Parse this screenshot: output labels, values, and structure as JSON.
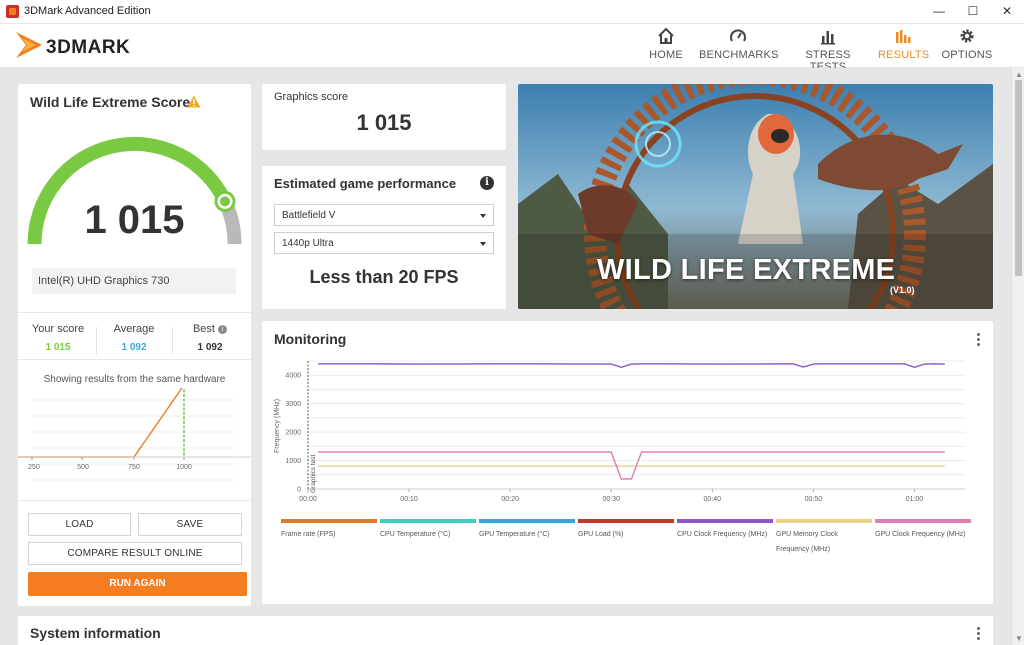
{
  "window": {
    "title": "3DMark Advanced Edition",
    "minimize": "—",
    "maximize": "☐",
    "close": "✕"
  },
  "header": {
    "logo_text": "3DMARK",
    "nav": [
      {
        "label": "HOME",
        "icon": "home-icon"
      },
      {
        "label": "BENCHMARKS",
        "icon": "gauge-icon"
      },
      {
        "label": "STRESS TESTS",
        "icon": "bar-chart-icon"
      },
      {
        "label": "RESULTS",
        "icon": "results-icon",
        "active": true
      },
      {
        "label": "OPTIONS",
        "icon": "gear-icon"
      }
    ]
  },
  "score_card": {
    "title": "Wild Life Extreme Score",
    "score": "1 015",
    "gauge_fraction": 0.86,
    "hardware": "Intel(R) UHD Graphics 730",
    "your_score_label": "Your score",
    "your_score": "1 015",
    "average_label": "Average",
    "average": "1 092",
    "best_label": "Best",
    "best": "1 092",
    "showing_text": "Showing results from the same hardware",
    "dist_ticks": [
      "250",
      "500",
      "750",
      "1000"
    ],
    "load_label": "LOAD",
    "save_label": "SAVE",
    "compare_label": "COMPARE RESULT ONLINE",
    "run_again_label": "RUN AGAIN"
  },
  "graphics": {
    "label": "Graphics score",
    "value": "1 015"
  },
  "game_perf": {
    "title": "Estimated game performance",
    "info_glyph": "i",
    "game": "Battlefield V",
    "preset": "1440p Ultra",
    "result": "Less than 20 FPS"
  },
  "hero": {
    "title": "WILD LIFE EXTREME",
    "version": "(V1.0)"
  },
  "monitoring": {
    "title": "Monitoring",
    "y_label": "Frequency (MHz)",
    "marker_label": "Graphics test",
    "y_ticks": [
      "4000",
      "3000",
      "2000",
      "1000",
      "0"
    ],
    "x_ticks": [
      "00:00",
      "00:10",
      "00:20",
      "00:30",
      "00:40",
      "00:50",
      "01:00"
    ],
    "legend": [
      {
        "label": "Frame rate (FPS)",
        "color": "#e07b2a"
      },
      {
        "label": "CPU Temperature (°C)",
        "color": "#3fd0bd"
      },
      {
        "label": "GPU Temperature (°C)",
        "color": "#34a6d9"
      },
      {
        "label": "GPU Load (%)",
        "color": "#c0392b"
      },
      {
        "label": "CPU Clock Frequency (MHz)",
        "color": "#8e55c7"
      },
      {
        "label": "GPU Memory Clock Frequency (MHz)",
        "color": "#e8cf8a"
      },
      {
        "label": "GPU Clock Frequency (MHz)",
        "color": "#e07fb3"
      }
    ]
  },
  "system_info": {
    "title": "System information"
  },
  "chart_data": {
    "type": "line",
    "title": "Monitoring",
    "xlabel": "",
    "ylabel": "Frequency (MHz)",
    "ylim": [
      0,
      4500
    ],
    "x": [
      0,
      5,
      10,
      20,
      29,
      30,
      31,
      32,
      33,
      40,
      47,
      48,
      49,
      50,
      58,
      59,
      60,
      61,
      62
    ],
    "series": [
      {
        "name": "CPU Clock Frequency (MHz)",
        "values": [
          4400,
          4400,
          4390,
          4400,
          4390,
          4280,
          4390,
          4400,
          4400,
          4390,
          4400,
          4290,
          4390,
          4400,
          4400,
          4280,
          4390,
          4400,
          4390
        ]
      },
      {
        "name": "GPU Memory Clock Frequency (MHz)",
        "values": [
          800,
          800,
          800,
          800,
          800,
          800,
          800,
          800,
          800,
          800,
          800,
          800,
          800,
          800,
          800,
          800,
          800,
          800,
          800
        ]
      },
      {
        "name": "GPU Clock Frequency (MHz)",
        "values": [
          1300,
          1300,
          1300,
          1300,
          1300,
          350,
          350,
          1300,
          1300,
          1300,
          1300,
          1300,
          1300,
          1300,
          1300,
          1300,
          1300,
          1300,
          1300
        ]
      }
    ],
    "grid": true
  }
}
